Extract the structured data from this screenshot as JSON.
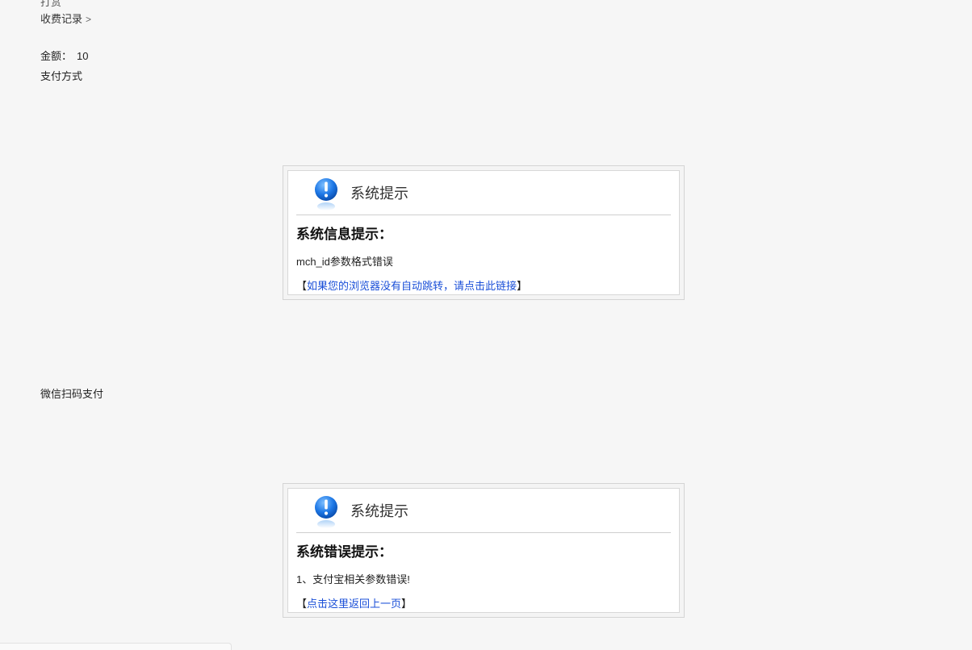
{
  "header": {
    "cut_text": "打赏",
    "breadcrumb_label": "收费记录",
    "breadcrumb_chevron": ">"
  },
  "amount": {
    "label": "金额：",
    "value": "10"
  },
  "payment": {
    "method_label": "支付方式",
    "wechat_label": "微信扫码支付"
  },
  "messages": [
    {
      "header_title": "系统提示",
      "subtitle": "系统信息提示：",
      "text": "mch_id参数格式错误",
      "link_open": "【",
      "link_text": "如果您的浏览器没有自动跳转，请点击此链接",
      "link_close": "】"
    },
    {
      "header_title": "系统提示",
      "subtitle": "系统错误提示：",
      "text": "1、支付宝相关参数错误!",
      "link_open": "【",
      "link_text": "点击这里返回上一页",
      "link_close": "】"
    }
  ],
  "colors": {
    "background": "#f6f6f6",
    "link": "#1a4fd8",
    "icon_blue": "#1e78e6"
  },
  "icons": {
    "message_icon": "info-exclamation-icon"
  }
}
